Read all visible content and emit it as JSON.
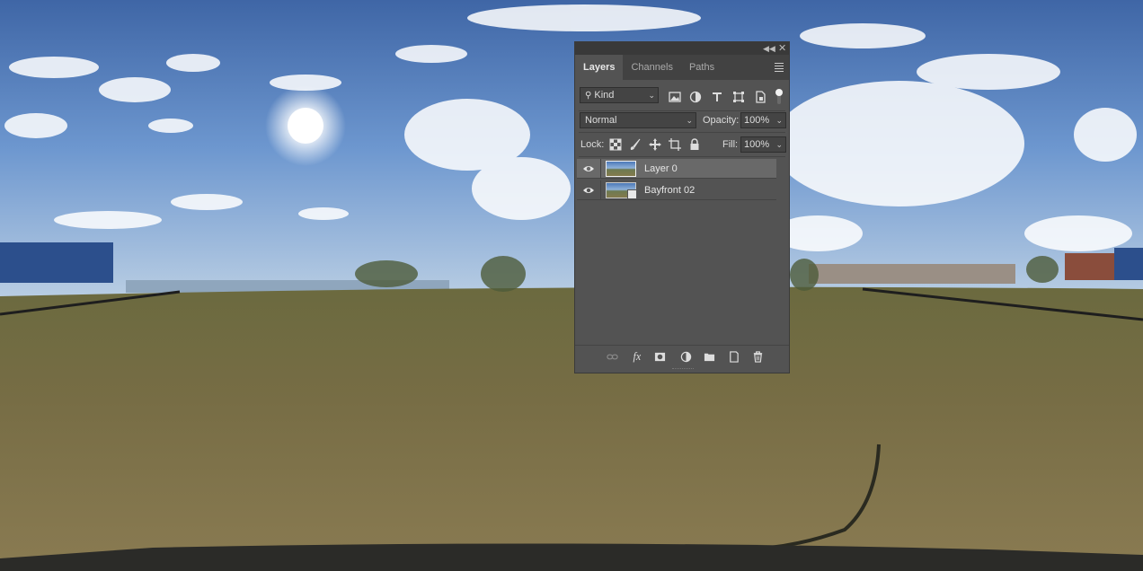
{
  "panel": {
    "tabs": [
      {
        "label": "Layers",
        "active": true
      },
      {
        "label": "Channels",
        "active": false
      },
      {
        "label": "Paths",
        "active": false
      }
    ],
    "filter": {
      "label": "Kind"
    },
    "blend_mode": "Normal",
    "opacity_label": "Opacity:",
    "opacity_value": "100%",
    "lock_label": "Lock:",
    "fill_label": "Fill:",
    "fill_value": "100%",
    "layers": [
      {
        "name": "Layer 0",
        "visible": true,
        "selected": true,
        "smart_object": false
      },
      {
        "name": "Bayfront 02",
        "visible": true,
        "selected": false,
        "smart_object": true
      }
    ]
  },
  "colors": {
    "panel_bg": "#535353",
    "selected_layer": "#696969",
    "tab_bar": "#424242"
  }
}
